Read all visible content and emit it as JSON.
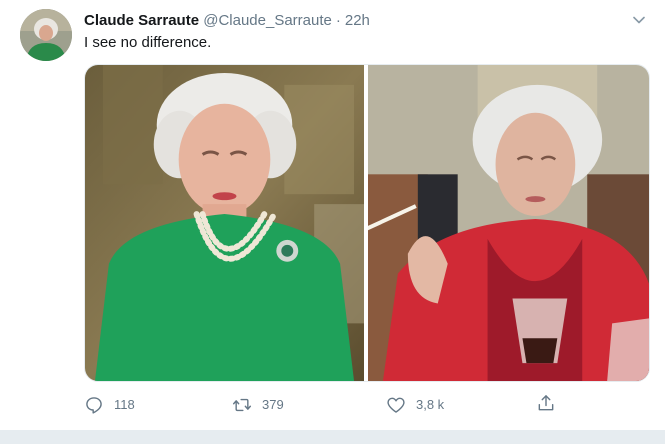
{
  "tweet": {
    "display_name": "Claude Sarraute",
    "handle": "@Claude_Sarraute",
    "separator": "·",
    "time": "22h",
    "text": "I see no difference.",
    "media": [
      {
        "icon": "photo-queen-green-dress"
      },
      {
        "icon": "photo-woman-red-cigarette"
      }
    ],
    "actions": {
      "reply_count": "118",
      "retweet_count": "379",
      "like_count": "3,8 k"
    }
  },
  "icons": {
    "avatar": "avatar-image",
    "caret": "chevron-down-icon",
    "reply": "reply-icon",
    "retweet": "retweet-icon",
    "like": "heart-icon",
    "share": "share-icon"
  },
  "colors": {
    "text_primary": "#14171a",
    "text_secondary": "#657786",
    "divider": "#e6ecf0"
  }
}
